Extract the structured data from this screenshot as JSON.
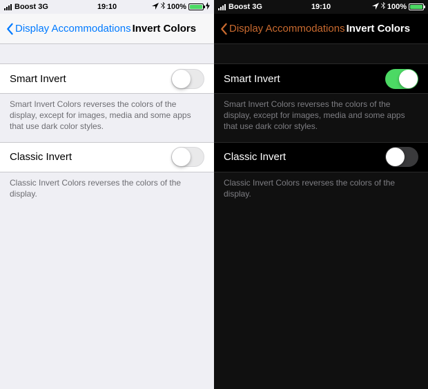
{
  "light": {
    "status": {
      "carrier": "Boost  3G",
      "time": "19:10",
      "battery": "100%"
    },
    "nav": {
      "back_label": "Display Accommodations",
      "title": "Invert Colors"
    },
    "smart": {
      "label": "Smart Invert",
      "on": false,
      "desc": "Smart Invert Colors reverses the colors of the display, except for images, media and some apps that use dark color styles."
    },
    "classic": {
      "label": "Classic Invert",
      "on": false,
      "desc": "Classic Invert Colors reverses the colors of the display."
    }
  },
  "dark": {
    "status": {
      "carrier": "Boost  3G",
      "time": "19:10",
      "battery": "100%"
    },
    "nav": {
      "back_label": "Display Accommodations",
      "title": "Invert Colors"
    },
    "smart": {
      "label": "Smart Invert",
      "on": true,
      "desc": "Smart Invert Colors reverses the colors of the display, except for images, media and some apps that use dark color styles."
    },
    "classic": {
      "label": "Classic Invert",
      "on": false,
      "desc": "Classic Invert Colors reverses the colors of the display."
    }
  }
}
